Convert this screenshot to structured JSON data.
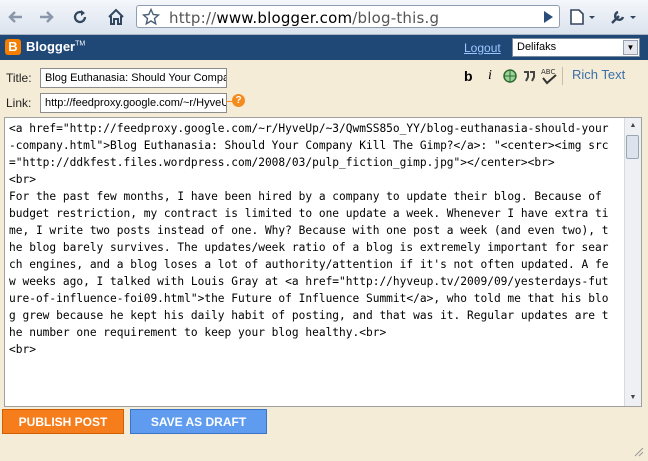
{
  "browser": {
    "url_scheme": "http://",
    "url_host": "www.blogger.com",
    "url_path": "/blog-this.g"
  },
  "header": {
    "app_name": "Blogger",
    "trademark": "TM",
    "logout_label": "Logout",
    "blog_selected": "Delifaks"
  },
  "form": {
    "title_label": "Title:",
    "title_value": "Blog Euthanasia: Should Your Compa",
    "link_label": "Link:",
    "link_value": "http://feedproxy.google.com/~r/HyveU",
    "help_glyph": "?",
    "bold_label": "b",
    "italic_label": "i",
    "rich_text_label": "Rich Text"
  },
  "editor": {
    "content": "<a href=\"http://feedproxy.google.com/~r/HyveUp/~3/QwmSS85o_YY/blog-euthanasia-should-your-company.html\">Blog Euthanasia: Should Your Company Kill The Gimp?</a>: \"<center><img src=\"http://ddkfest.files.wordpress.com/2008/03/pulp_fiction_gimp.jpg\"></center><br>\n<br>\nFor the past few months, I have been hired by a company to update their blog. Because of budget restriction, my contract is limited to one update a week. Whenever I have extra time, I write two posts instead of one. Why? Because with one post a week (and even two), the blog barely survives. The updates/week ratio of a blog is extremely important for search engines, and a blog loses a lot of authority/attention if it's not often updated. A few weeks ago, I talked with Louis Gray at <a href=\"http://hyveup.tv/2009/09/yesterdays-future-of-influence-foi09.html\">the Future of Influence Summit</a>, who told me that his blog grew because he kept his daily habit of posting, and that was it. Regular updates are the number one requirement to keep your blog healthy.<br>\n<br>"
  },
  "buttons": {
    "publish_label": "PUBLISH POST",
    "draft_label": "SAVE AS DRAFT"
  }
}
